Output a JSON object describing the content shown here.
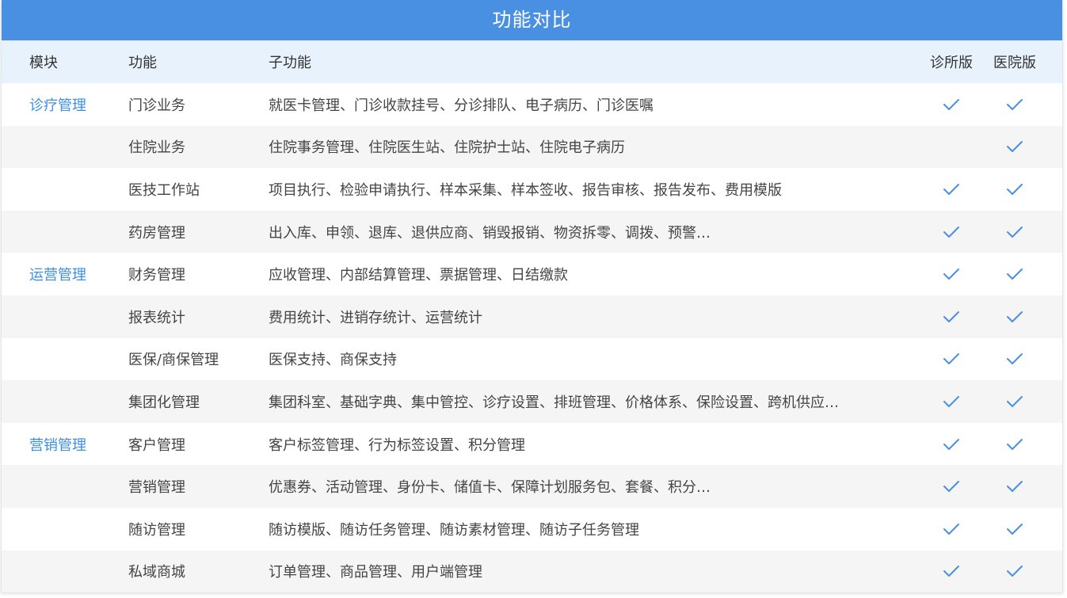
{
  "title": "功能对比",
  "colors": {
    "title_bar": "#4a90e2",
    "header_bg": "#e8f2fd",
    "module_text": "#3d8fe6",
    "check": "#4a90e2"
  },
  "headers": {
    "module": "模块",
    "function": "功能",
    "sub_function": "子功能",
    "clinic": "诊所版",
    "hospital": "医院版"
  },
  "rows": [
    {
      "module": "诊疗管理",
      "function": "门诊业务",
      "sub": "就医卡管理、门诊收款挂号、分诊排队、电子病历、门诊医嘱",
      "clinic": true,
      "hospital": true
    },
    {
      "module": "",
      "function": "住院业务",
      "sub": "住院事务管理、住院医生站、住院护士站、住院电子病历",
      "clinic": false,
      "hospital": true
    },
    {
      "module": "",
      "function": "医技工作站",
      "sub": "项目执行、检验申请执行、样本采集、样本签收、报告审核、报告发布、费用模版",
      "clinic": true,
      "hospital": true
    },
    {
      "module": "",
      "function": "药房管理",
      "sub": "出入库、申领、退库、退供应商、销毁报销、物资拆零、调拨、预警…",
      "clinic": true,
      "hospital": true
    },
    {
      "module": "运营管理",
      "function": "财务管理",
      "sub": "应收管理、内部结算管理、票据管理、日结缴款",
      "clinic": true,
      "hospital": true
    },
    {
      "module": "",
      "function": "报表统计",
      "sub": "费用统计、进销存统计、运营统计",
      "clinic": true,
      "hospital": true
    },
    {
      "module": "",
      "function": "医保/商保管理",
      "sub": "医保支持、商保支持",
      "clinic": true,
      "hospital": true
    },
    {
      "module": "",
      "function": "集团化管理",
      "sub": "集团科室、基础字典、集中管控、诊疗设置、排班管理、价格体系、保险设置、跨机供应…",
      "clinic": true,
      "hospital": true
    },
    {
      "module": "营销管理",
      "function": "客户管理",
      "sub": "客户标签管理、行为标签设置、积分管理",
      "clinic": true,
      "hospital": true
    },
    {
      "module": "",
      "function": "营销管理",
      "sub": "优惠券、活动管理、身份卡、储值卡、保障计划服务包、套餐、积分…",
      "clinic": true,
      "hospital": true
    },
    {
      "module": "",
      "function": "随访管理",
      "sub": "随访模版、随访任务管理、随访素材管理、随访子任务管理",
      "clinic": true,
      "hospital": true
    },
    {
      "module": "",
      "function": "私域商城",
      "sub": "订单管理、商品管理、用户端管理",
      "clinic": true,
      "hospital": true
    }
  ]
}
